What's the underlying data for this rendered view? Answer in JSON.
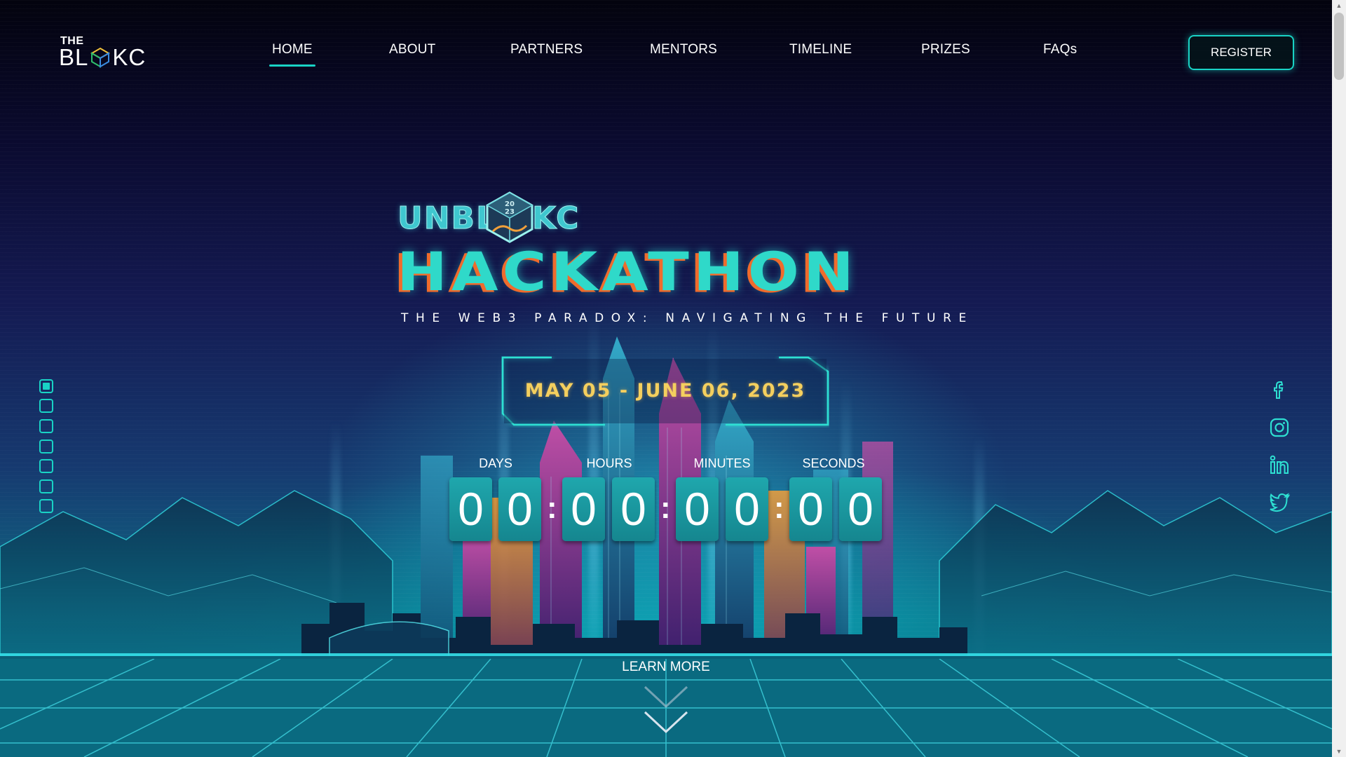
{
  "header": {
    "logo_top": "THE",
    "logo_left": "BL",
    "logo_right": "KC",
    "nav": [
      "HOME",
      "ABOUT",
      "PARTNERS",
      "MENTORS",
      "TIMELINE",
      "PRIZES",
      "FAQs"
    ],
    "active_nav": "HOME",
    "register_label": "REGISTER"
  },
  "hero": {
    "brand_left": "UNBL",
    "brand_right": "KC",
    "brand_cube_top": "20",
    "brand_cube_bottom": "23",
    "title": "HACKATHON",
    "tagline": "THE WEB3 PARADOX: NAVIGATING THE FUTURE",
    "date": "MAY 05 - JUNE 06, 2023"
  },
  "countdown": {
    "labels": [
      "DAYS",
      "HOURS",
      "MINUTES",
      "SECONDS"
    ],
    "digits": [
      "0",
      "0",
      "0",
      "0",
      "0",
      "0",
      "0",
      "0"
    ],
    "separator": ":"
  },
  "learn_more": "LEARN MORE",
  "section_dots": {
    "count": 7,
    "active_index": 0
  },
  "social": [
    "facebook-icon",
    "instagram-icon",
    "linkedin-icon",
    "twitter-icon"
  ],
  "colors": {
    "accent": "#19d3c5",
    "date_gold": "#f4cf5e",
    "title_teal": "#2fd9c9",
    "title_orange": "#ef6b2c",
    "digit_bg": "#1a969d"
  }
}
